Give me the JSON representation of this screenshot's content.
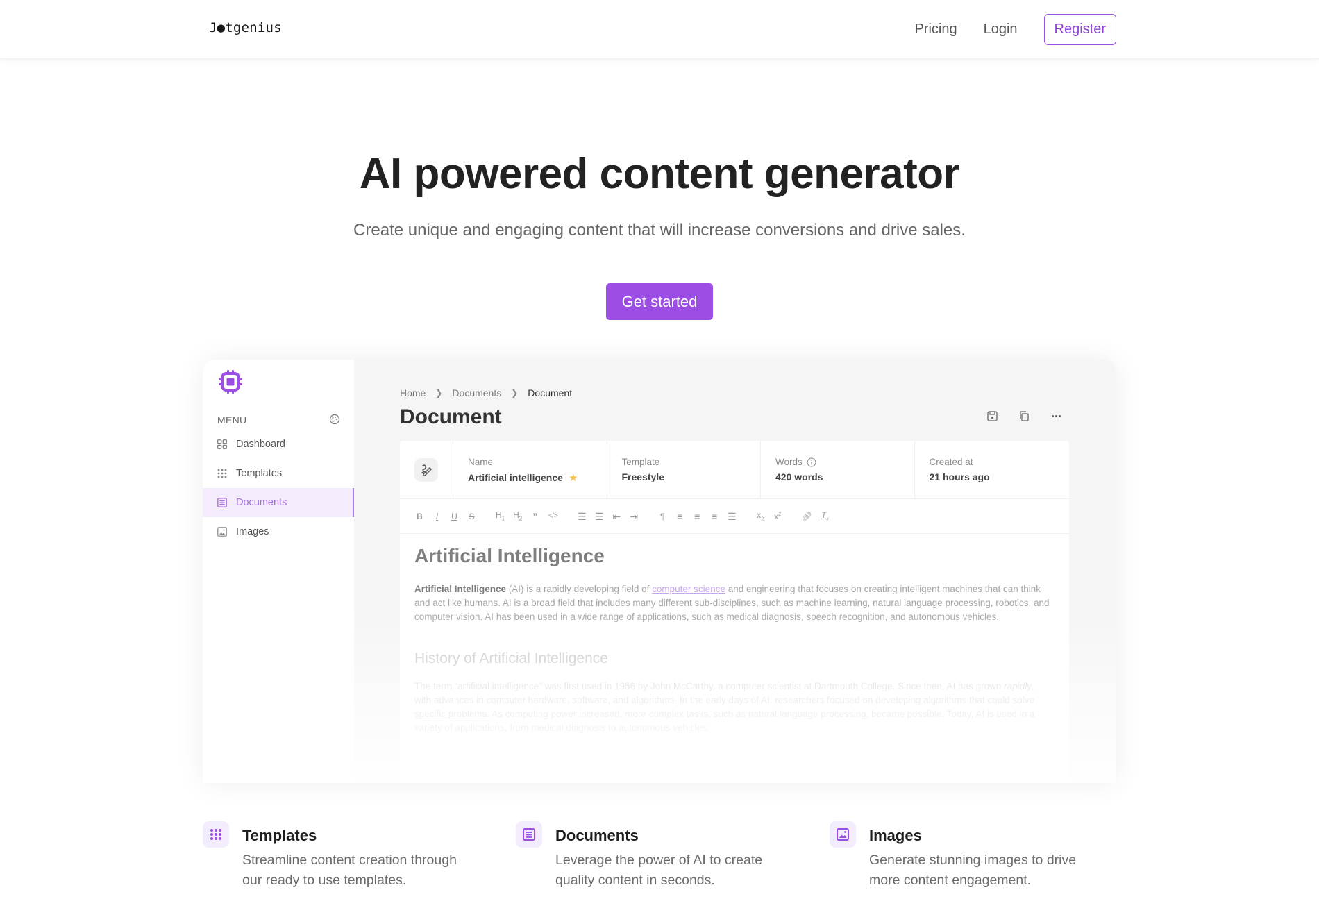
{
  "nav": {
    "logo": "J●tgenius",
    "links": [
      "Pricing",
      "Login"
    ],
    "register_label": "Register"
  },
  "hero": {
    "title": "AI powered content generator",
    "subtitle": "Create unique and engaging content that will increase conversions and drive sales.",
    "cta_label": "Get started"
  },
  "app": {
    "sidebar": {
      "menu_label": "MENU",
      "items": [
        {
          "label": "Dashboard",
          "icon": "dashboard-icon",
          "active": false
        },
        {
          "label": "Templates",
          "icon": "grid-dots-icon",
          "active": false
        },
        {
          "label": "Documents",
          "icon": "document-icon",
          "active": true
        },
        {
          "label": "Images",
          "icon": "image-icon",
          "active": false
        }
      ]
    },
    "breadcrumb": [
      "Home",
      "Documents",
      "Document"
    ],
    "page_title": "Document",
    "actions": [
      "save-icon",
      "copy-icon",
      "more-icon"
    ],
    "meta": {
      "name_label": "Name",
      "name_value": "Artificial intelligence",
      "template_label": "Template",
      "template_value": "Freestyle",
      "words_label": "Words",
      "words_value": "420 words",
      "created_label": "Created at",
      "created_value": "21 hours ago"
    },
    "toolbar": [
      "B",
      "I",
      "U",
      "S",
      "H1",
      "H2",
      "quote",
      "code",
      "ordered-list",
      "bullet-list",
      "outdent",
      "indent",
      "rtl",
      "align-left",
      "align-center",
      "align-right",
      "justify",
      "subscript",
      "superscript",
      "link",
      "clear-format"
    ],
    "content": {
      "h1": "Artificial Intelligence",
      "p1_bold": "Artificial Intelligence",
      "p1_a": " (AI) is a rapidly developing field of ",
      "p1_link": "computer science",
      "p1_b": " and engineering that focuses on creating intelligent machines that can think and act like humans. AI is a broad field that includes many different sub-disciplines, such as machine learning, natural language processing, robotics, and computer vision. AI has been used in a wide range of applications, such as medical diagnosis, speech recognition, and autonomous vehicles.",
      "h2": "History of Artificial Intelligence",
      "p2_a": "The term “artificial intelligence” was first used in 1956 by John McCarthy, a computer scientist at Dartmouth College. Since then, AI has grown ",
      "p2_em": "rapidly",
      "p2_b": ", with advances in computer hardware, software, and algorithms. In the early days of AI, researchers focused on developing algorithms that could solve ",
      "p2_link": "specific problems",
      "p2_c": ". As computing power increased, more complex tasks, such as natural language processing, became possible. Today, AI is used in a variety of applications, from medical diagnosis to autonomous vehicles."
    }
  },
  "features": [
    {
      "title": "Templates",
      "desc": "Streamline content creation through our ready to use templates.",
      "icon": "grid-dots-icon"
    },
    {
      "title": "Documents",
      "desc": "Leverage the power of AI to create quality content in seconds.",
      "icon": "document-icon"
    },
    {
      "title": "Images",
      "desc": "Generate stunning images to drive more content engagement.",
      "icon": "image-icon"
    }
  ],
  "colors": {
    "accent": "#9b4de4",
    "accent_light": "#f3ecfd",
    "star": "#f5c453"
  }
}
